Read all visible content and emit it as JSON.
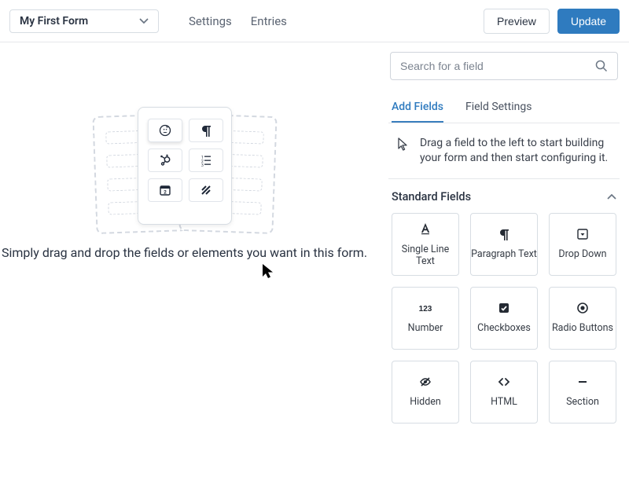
{
  "header": {
    "form_name": "My First Form",
    "nav": {
      "settings": "Settings",
      "entries": "Entries"
    },
    "preview": "Preview",
    "update": "Update"
  },
  "search": {
    "placeholder": "Search for a field"
  },
  "tabs": {
    "add": "Add Fields",
    "settings": "Field Settings",
    "active": "add"
  },
  "hint": "Drag a field to the left to start building your form and then start configuring it.",
  "canvas_caption": "Simply drag and drop the fields or elements you want in this form.",
  "section": {
    "title": "Standard Fields",
    "expanded": true
  },
  "fields": [
    {
      "id": "single-line-text",
      "label": "Single Line Text",
      "icon": "text-format"
    },
    {
      "id": "paragraph-text",
      "label": "Paragraph Text",
      "icon": "paragraph"
    },
    {
      "id": "drop-down",
      "label": "Drop Down",
      "icon": "dropdown"
    },
    {
      "id": "number",
      "label": "Number",
      "icon": "number"
    },
    {
      "id": "checkboxes",
      "label": "Checkboxes",
      "icon": "checkbox"
    },
    {
      "id": "radio-buttons",
      "label": "Radio Buttons",
      "icon": "radio"
    },
    {
      "id": "hidden",
      "label": "Hidden",
      "icon": "hidden"
    },
    {
      "id": "html",
      "label": "HTML",
      "icon": "code"
    },
    {
      "id": "section",
      "label": "Section",
      "icon": "minus"
    }
  ],
  "illustration_icons": {
    "r1c1": "mailchimp",
    "r1c2": "paragraph",
    "r2c1": "hubspot",
    "r2c2": "ordered-list",
    "r3c1": "date",
    "r3c2": "stripes"
  }
}
